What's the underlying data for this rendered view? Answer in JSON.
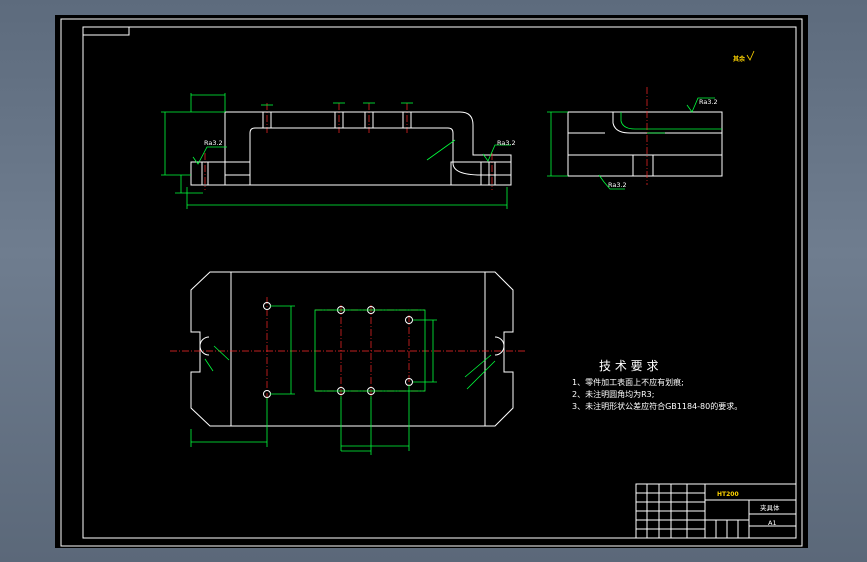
{
  "tech_requirements": {
    "title": "技 术 要 求",
    "items": [
      "1、零件加工表面上不应有划痕;",
      "2、未注明圆角均为R3;",
      "3、未注明形状公差应符合GB1184-80的要求。"
    ]
  },
  "roughness": {
    "left_top": "Ra3.2",
    "left_right": "Ra3.2",
    "side_top": "Ra3.2",
    "side_bottom": "Ra3.2",
    "general": "其余"
  },
  "title_block": {
    "material": "HT200",
    "part_name": "夹具体",
    "scale": "A1"
  },
  "colors": {
    "background": "#000000",
    "outline": "#ffffff",
    "dimension": "#00ff3c",
    "centerline": "#ff2a2a",
    "highlight": "#ffd400",
    "frame_bg": "#6b7889"
  }
}
